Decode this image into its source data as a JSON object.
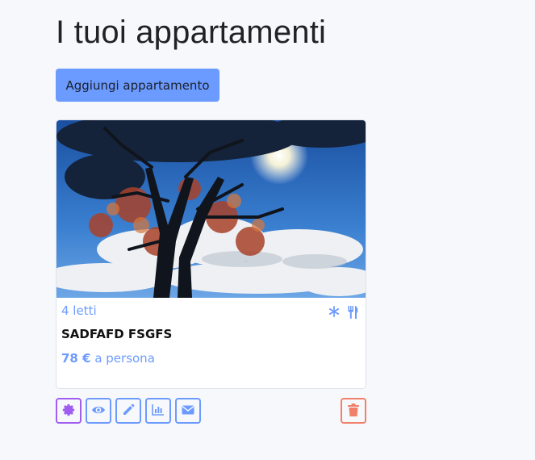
{
  "header": {
    "title": "I tuoi appartamenti"
  },
  "toolbar": {
    "add_label": "Aggiungi appartamento"
  },
  "listing": {
    "beds": "4 letti",
    "name": "SADFAFD FSGFS",
    "price": "78 €",
    "price_suffix": " a persona",
    "amenity_icons": [
      "snowflake-icon",
      "utensils-icon"
    ]
  },
  "actions": [
    "badge-icon",
    "eye-icon",
    "pencil-icon",
    "chart-icon",
    "envelope-icon",
    "trash-icon"
  ],
  "colors": {
    "accent": "#6c9bff",
    "purple": "#a05ef0",
    "danger": "#f0806a",
    "background": "#f7f8fc"
  }
}
